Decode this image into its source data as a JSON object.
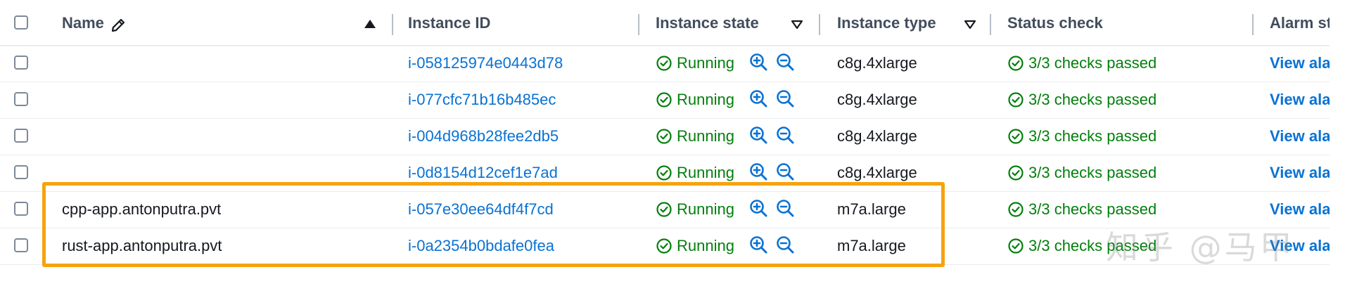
{
  "columns": {
    "name": "Name",
    "instance_id": "Instance ID",
    "instance_state": "Instance state",
    "instance_type": "Instance type",
    "status_check": "Status check",
    "alarm_status": "Alarm st"
  },
  "rows": [
    {
      "name": "",
      "instance_id": "i-058125974e0443d78",
      "state": "Running",
      "type": "c8g.4xlarge",
      "status": "3/3 checks passed",
      "alarm": "View ala"
    },
    {
      "name": "",
      "instance_id": "i-077cfc71b16b485ec",
      "state": "Running",
      "type": "c8g.4xlarge",
      "status": "3/3 checks passed",
      "alarm": "View ala"
    },
    {
      "name": "",
      "instance_id": "i-004d968b28fee2db5",
      "state": "Running",
      "type": "c8g.4xlarge",
      "status": "3/3 checks passed",
      "alarm": "View ala"
    },
    {
      "name": "",
      "instance_id": "i-0d8154d12cef1e7ad",
      "state": "Running",
      "type": "c8g.4xlarge",
      "status": "3/3 checks passed",
      "alarm": "View ala"
    },
    {
      "name": "cpp-app.antonputra.pvt",
      "instance_id": "i-057e30ee64df4f7cd",
      "state": "Running",
      "type": "m7a.large",
      "status": "3/3 checks passed",
      "alarm": "View ala"
    },
    {
      "name": "rust-app.antonputra.pvt",
      "instance_id": "i-0a2354b0bdafe0fea",
      "state": "Running",
      "type": "m7a.large",
      "status": "3/3 checks passed",
      "alarm": "View ala"
    }
  ],
  "watermark": "知乎 @马甲",
  "colors": {
    "link": "#0972d3",
    "success": "#037f0c",
    "highlight": "#f5a30f"
  },
  "icons": {
    "edit": "pencil-icon",
    "sort_asc": "caret-up-icon",
    "filter": "caret-down-outline-icon",
    "running": "check-circle-icon",
    "zoom_in": "zoom-in-icon",
    "zoom_out": "zoom-out-icon"
  }
}
